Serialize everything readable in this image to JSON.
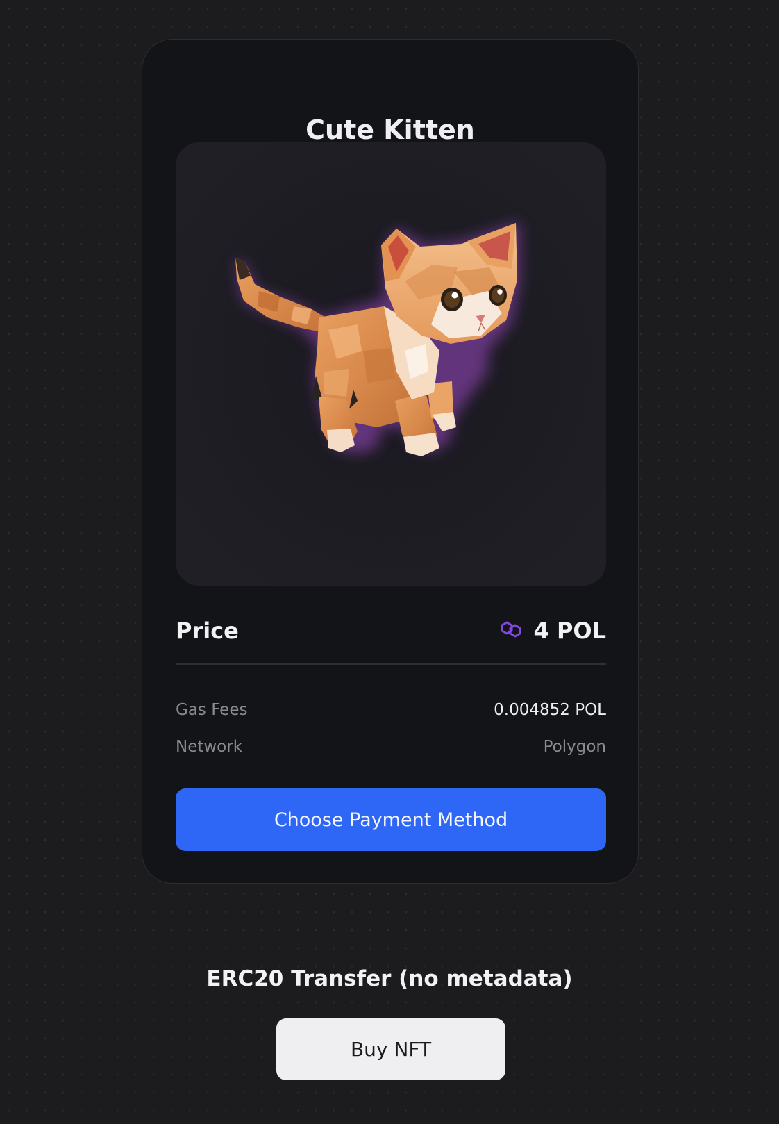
{
  "card": {
    "title": "Cute Kitten",
    "image_alt": "Cute Kitten",
    "price_label": "Price",
    "price_value": "4 POL",
    "currency_icon": "polygon-icon",
    "fees": [
      {
        "label": "Gas Fees",
        "value": "0.004852 POL"
      },
      {
        "label": "Network",
        "value": "Polygon"
      }
    ],
    "pay_button_label": "Choose Payment Method"
  },
  "section": {
    "title": "ERC20 Transfer (no metadata)",
    "buy_button_label": "Buy NFT"
  },
  "colors": {
    "page_background": "#1c1c1f",
    "card_background": "#131417",
    "accent_blue": "#2e66f5",
    "polygon_purple": "#8247e5"
  }
}
